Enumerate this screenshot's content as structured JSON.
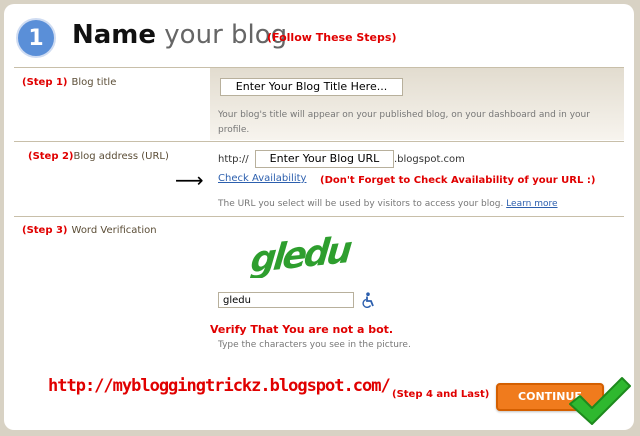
{
  "header": {
    "step_number": "1",
    "title_bold": "Name",
    "title_rest": "your blog",
    "follow_note": "(Follow These Steps)"
  },
  "rows": {
    "title": {
      "step_tag": "(Step 1)",
      "label": "Blog title",
      "input_value": "Enter Your Blog Title Here...",
      "help_line1": "Your blog's title will appear on your published blog, on your dashboard and in your",
      "help_line2": "profile."
    },
    "address": {
      "step_tag": "(Step 2)",
      "label": "Blog address (URL)",
      "prefix": "http://",
      "input_value": "Enter Your Blog URL",
      "suffix": ".blogspot.com",
      "check_link": "Check Availability",
      "check_note": "(Don't Forget to Check Availability of your URL :)",
      "help_text": "The URL you select will be used by visitors to access your blog.",
      "learn_more": "Learn more"
    },
    "verification": {
      "step_tag": "(Step 3)",
      "label": "Word Verification",
      "captcha_word": "gledu",
      "input_value": "gledu",
      "verify_message": "Verify That You are not a bot.",
      "help_text": "Type the characters you see in the picture."
    }
  },
  "footer": {
    "blog_url": "http://mybloggingtrickz.blogspot.com/",
    "step4": "(Step 4 and Last)",
    "continue_label": "CONTINUE"
  },
  "colors": {
    "accent_red": "#e00000",
    "step_blue": "#5a8fd8",
    "link_blue": "#2c5fae",
    "continue_orange": "#f07b1d",
    "check_green": "#2fb82f",
    "captcha_green": "#2e9e2e"
  }
}
